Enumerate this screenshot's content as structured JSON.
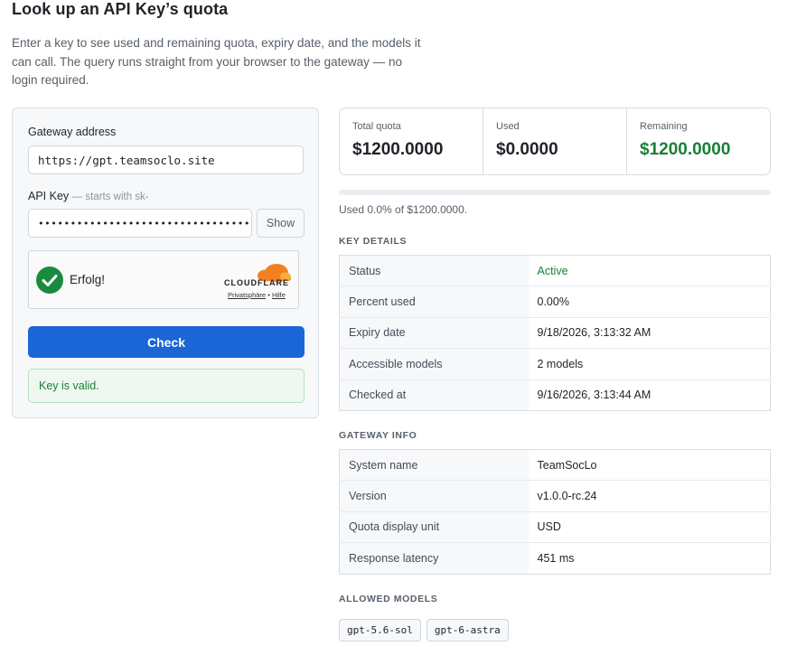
{
  "page": {
    "title": "Look up an API Key’s quota",
    "intro": "Enter a key to see used and remaining quota, expiry date, and the models it can call. The query runs straight from your browser to the gateway — no login required."
  },
  "form": {
    "gateway_label": "Gateway address",
    "gateway_value": "https://gpt.teamsoclo.site",
    "key_label": "API Key",
    "key_hint": "— starts with sk-",
    "key_value": "••••••••••••••••••••••••••••••••••••",
    "show_label": "Show",
    "captcha": {
      "status_text": "Erfolg!",
      "brand": "CLOUDFLARE",
      "privacy_link": "Privatsphäre",
      "separator": "•",
      "help_link": "Hilfe",
      "icon": "check-circle-icon",
      "brand_color": "#f38020"
    },
    "check_label": "Check",
    "valid_message": "Key is valid."
  },
  "stats": {
    "total_label": "Total quota",
    "total_value": "$1200.0000",
    "used_label": "Used",
    "used_value": "$0.0000",
    "remaining_label": "Remaining",
    "remaining_value": "$1200.0000",
    "used_percent": 0.0,
    "used_summary": "Used 0.0% of $1200.0000."
  },
  "key_details": {
    "title": "KEY DETAILS",
    "rows": [
      {
        "key": "Status",
        "value": "Active"
      },
      {
        "key": "Percent used",
        "value": "0.00%"
      },
      {
        "key": "Expiry date",
        "value": "9/18/2026, 3:13:32 AM"
      },
      {
        "key": "Accessible models",
        "value": "2 models"
      },
      {
        "key": "Checked at",
        "value": "9/16/2026, 3:13:44 AM"
      }
    ]
  },
  "gateway_info": {
    "title": "GATEWAY INFO",
    "rows": [
      {
        "key": "System name",
        "value": "TeamSocLo"
      },
      {
        "key": "Version",
        "value": "v1.0.0-rc.24"
      },
      {
        "key": "Quota display unit",
        "value": "USD"
      },
      {
        "key": "Response latency",
        "value": "451 ms"
      }
    ]
  },
  "allowed_models": {
    "title": "ALLOWED MODELS",
    "models": [
      "gpt-5.6-sol",
      "gpt-6-astra"
    ]
  },
  "colors": {
    "accent": "#1b66d6",
    "success": "#1a7f37"
  }
}
